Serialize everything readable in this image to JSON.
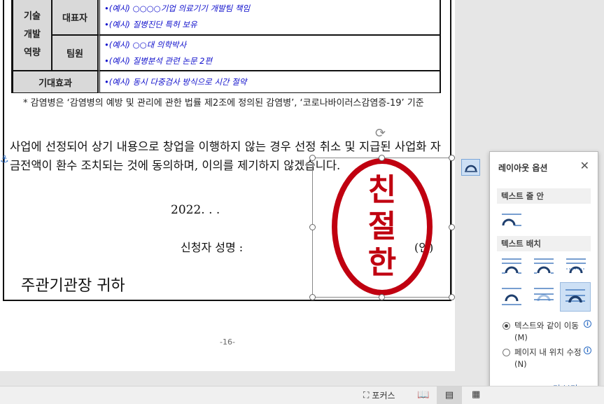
{
  "table": {
    "row1_header": "기술\n개발\n역량",
    "row1_sub1": "대표자",
    "row1_sub1_lines": [
      "•(예시) ○○○○기업 의료기기 개발팀 책임",
      "•(예시) 질병진단 특허 보유"
    ],
    "row1_sub2": "팀원",
    "row1_sub2_lines": [
      "•(예시) ○○대 의학박사",
      "•(예시) 질병분석 관련 논문 2편"
    ],
    "row2_header": "기대효과",
    "row2_line": "•(예시) 동시 다중검사 방식으로 시간 절약"
  },
  "note": "* 감염병은 ‘감염병의 예방 및 관리에 관한 법률 제2조에 정의된 감염병’, ‘코로나바이러스감염증-19’ 기준",
  "paragraph": "사업에 선정되어 상기 내용으로 창업을 이행하지 않는 경우 선정 취소 및 지급된 사업화 자금전액이 환수 조치되는 것에 동의하며, 이의를 제기하지 않겠습니다.",
  "date": "2022.     .     .",
  "applicant": "신청자 성명 :",
  "seal_mark": "(인)",
  "addressee": "주관기관장 귀하",
  "stamp_chars": [
    "친",
    "절",
    "한"
  ],
  "page_number": "-16-",
  "status": {
    "focus": "포커스"
  },
  "panel": {
    "title": "레이아웃 옵션",
    "section_inline": "텍스트 줄 안",
    "section_wrap": "텍스트 배치",
    "radio1": "텍스트와 같이 이동(M)",
    "radio2": "페이지 내 위치 수정(N)",
    "more": "더 보기..."
  },
  "colors": {
    "stamp": "#c00010",
    "example_text": "#1010cc",
    "accent": "#2b5fa8"
  }
}
